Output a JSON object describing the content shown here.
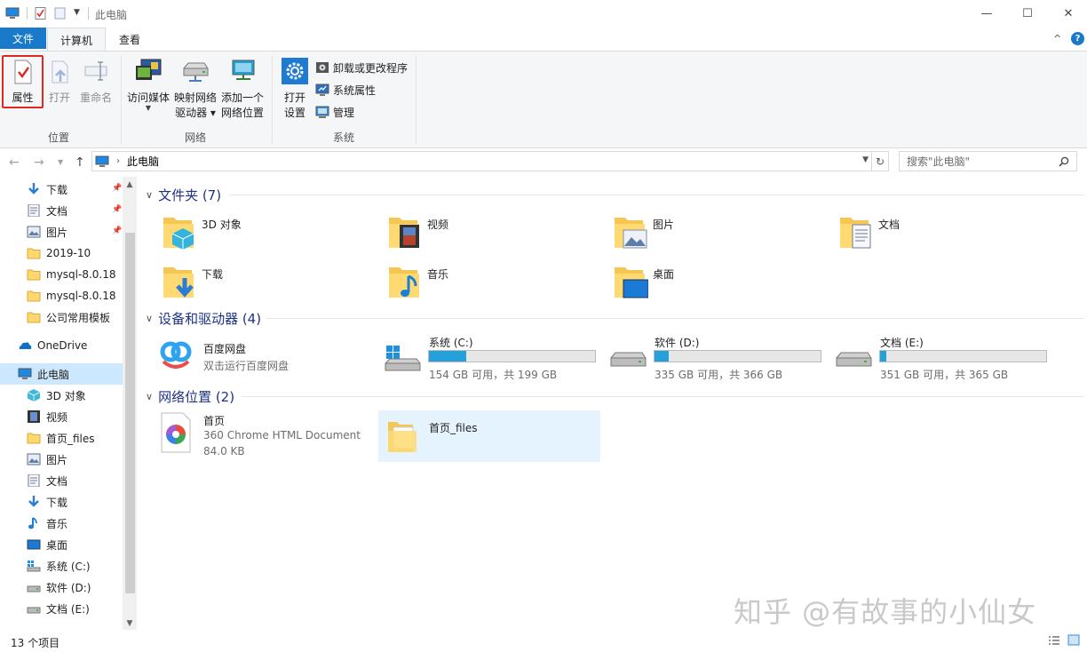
{
  "titlebar": {
    "title": "此电脑",
    "minimize": "—",
    "maximize": "☐",
    "close": "✕"
  },
  "tabs": {
    "file": "文件",
    "computer": "计算机",
    "view": "查看",
    "collapse": "^",
    "help": "?"
  },
  "ribbon": {
    "location": {
      "label": "位置",
      "properties": "属性",
      "open": "打开",
      "rename": "重命名"
    },
    "network": {
      "label": "网络",
      "access_media": "访问媒体",
      "map_drive_line1": "映射网络",
      "map_drive_line2": "驱动器 ▾",
      "add_location_line1": "添加一个",
      "add_location_line2": "网络位置"
    },
    "system": {
      "label": "系统",
      "open_settings_line1": "打开",
      "open_settings_line2": "设置",
      "uninstall": "卸载或更改程序",
      "system_properties": "系统属性",
      "manage": "管理"
    },
    "highlight_color": "#e0281e"
  },
  "address": {
    "path": "此电脑",
    "search_placeholder": "搜索\"此电脑\""
  },
  "sidebar": {
    "quick_access": [
      {
        "label": "下载",
        "icon": "download-arrow-icon",
        "pinned": true
      },
      {
        "label": "文档",
        "icon": "document-icon",
        "pinned": true
      },
      {
        "label": "图片",
        "icon": "picture-icon",
        "pinned": true
      },
      {
        "label": "2019-10",
        "icon": "folder-icon",
        "pinned": false
      },
      {
        "label": "mysql-8.0.18",
        "icon": "folder-icon",
        "pinned": false
      },
      {
        "label": "mysql-8.0.18",
        "icon": "folder-icon",
        "pinned": false
      },
      {
        "label": "公司常用模板",
        "icon": "folder-icon",
        "pinned": false
      }
    ],
    "onedrive": "OneDrive",
    "this_pc": "此电脑",
    "this_pc_items": [
      {
        "label": "3D 对象",
        "icon": "cube-icon"
      },
      {
        "label": "视频",
        "icon": "video-icon"
      },
      {
        "label": "首页_files",
        "icon": "folder-icon"
      },
      {
        "label": "图片",
        "icon": "picture-icon"
      },
      {
        "label": "文档",
        "icon": "document-icon"
      },
      {
        "label": "下载",
        "icon": "download-arrow-icon"
      },
      {
        "label": "音乐",
        "icon": "music-note-icon"
      },
      {
        "label": "桌面",
        "icon": "desktop-icon"
      },
      {
        "label": "系统 (C:)",
        "icon": "windows-drive-icon"
      },
      {
        "label": "软件 (D:)",
        "icon": "drive-icon"
      },
      {
        "label": "文档 (E:)",
        "icon": "drive-icon"
      }
    ]
  },
  "content": {
    "folders_header": "文件夹 (7)",
    "folders": [
      {
        "name": "3D 对象",
        "icon": "cube-icon"
      },
      {
        "name": "视频",
        "icon": "video-icon"
      },
      {
        "name": "图片",
        "icon": "picture-icon"
      },
      {
        "name": "文档",
        "icon": "document-icon"
      },
      {
        "name": "下载",
        "icon": "download-arrow-icon"
      },
      {
        "name": "音乐",
        "icon": "music-note-icon"
      },
      {
        "name": "桌面",
        "icon": "desktop-icon"
      }
    ],
    "devices_header": "设备和驱动器 (4)",
    "baidu": {
      "name": "百度网盘",
      "sub": "双击运行百度网盘"
    },
    "drives": [
      {
        "name": "系统 (C:)",
        "info": "154 GB 可用，共 199 GB",
        "used_fraction": 0.226,
        "icon": "windows-drive-icon"
      },
      {
        "name": "软件 (D:)",
        "info": "335 GB 可用，共 366 GB",
        "used_fraction": 0.085,
        "icon": "drive-icon"
      },
      {
        "name": "文档 (E:)",
        "info": "351 GB 可用，共 365 GB",
        "used_fraction": 0.038,
        "icon": "drive-icon"
      }
    ],
    "network_header": "网络位置 (2)",
    "network_items": [
      {
        "name": "首页",
        "sub1": "360 Chrome HTML Document",
        "sub2": "84.0 KB"
      },
      {
        "name": "首页_files"
      }
    ]
  },
  "status": {
    "count": "13 个项目"
  },
  "watermark": "知乎 @有故事的小仙女"
}
